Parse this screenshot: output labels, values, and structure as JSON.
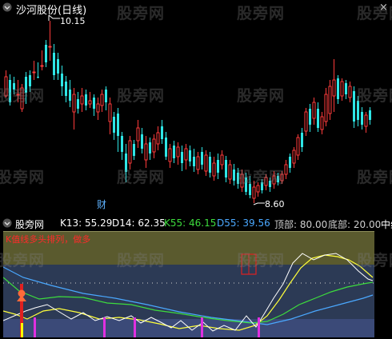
{
  "header": {
    "title": "沙河股份(日线)",
    "close_glyph": "×"
  },
  "watermark": "股旁网",
  "main": {
    "high_label": "10.15",
    "low_label": "8.60",
    "event_label": "财",
    "up_color": "#ff3b3b",
    "down_color": "#2ee6e6"
  },
  "indicator": {
    "name": "股旁网",
    "k13": "K13: 55.29",
    "d14": "D14: 62.35",
    "k55": "K55: 46.15",
    "d55": "D55: 39.56",
    "top": "顶部: 80.00",
    "bottom": "底部: 20.00",
    "truncated": "中线",
    "annotation": "K值线多头排列，做多"
  }
}
